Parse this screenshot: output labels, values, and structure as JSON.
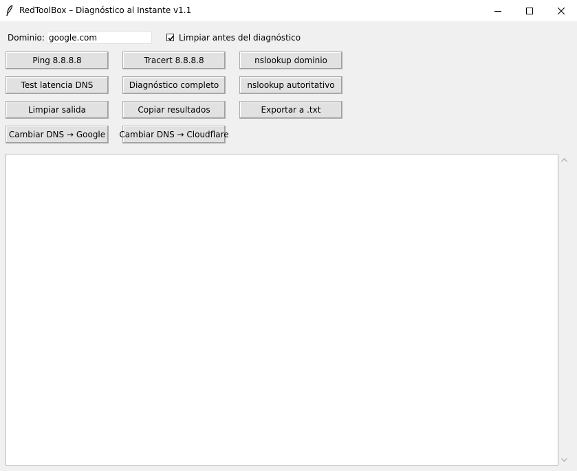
{
  "window": {
    "title": "RedToolBox – Diagnóstico al Instante v1.1",
    "icons": [
      "feather-icon",
      "minimize-icon",
      "maximize-icon",
      "close-icon"
    ]
  },
  "form": {
    "domain_label": "Dominio:",
    "domain_value": "google.com",
    "clear_checkbox_label": "Limpiar antes del diagnóstico",
    "clear_checkbox_checked": true
  },
  "buttons": {
    "ping": "Ping 8.8.8.8",
    "tracert": "Tracert 8.8.8.8",
    "nslookup_domain": "nslookup dominio",
    "dns_latency": "Test latencia DNS",
    "full_diagnostic": "Diagnóstico completo",
    "nslookup_auth": "nslookup autoritativo",
    "clear_output": "Limpiar salida",
    "copy_results": "Copiar resultados",
    "export_txt": "Exportar a .txt",
    "dns_google": "Cambiar DNS → Google",
    "dns_cloudflare": "Cambiar DNS → Cloudflare"
  },
  "output": {
    "text": ""
  }
}
